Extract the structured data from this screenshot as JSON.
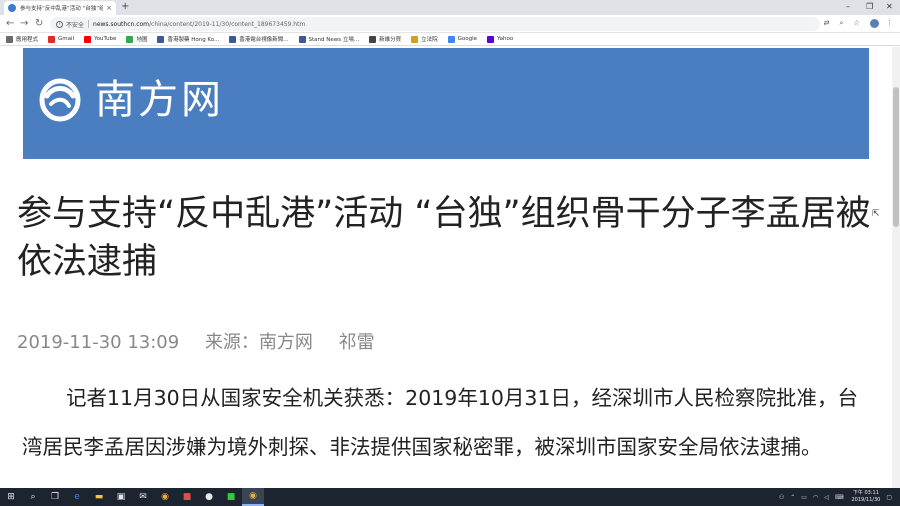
{
  "browser": {
    "tab": {
      "title": "参与支持“反中乱港”活动 “台独”组织骨干分子李孟居被依法逮捕",
      "close": "×"
    },
    "new_tab": "+",
    "window_controls": {
      "minimize": "–",
      "restore": "❐",
      "close": "✕"
    },
    "nav": {
      "back": "←",
      "forward": "→",
      "reload": "↻"
    },
    "address": {
      "security_label": "不安全",
      "host": "news.southcn.com",
      "path": "/china/content/2019-11/30/content_189673459.htm"
    },
    "bookmarks": [
      {
        "label": "應用程式",
        "color": "#6a6a6a"
      },
      {
        "label": "Gmail",
        "color": "#d93025"
      },
      {
        "label": "YouTube",
        "color": "#ff0000"
      },
      {
        "label": "地圖",
        "color": "#34a853"
      },
      {
        "label": "香港製藥 Hong Ko...",
        "color": "#3b5998"
      },
      {
        "label": "香港電台視像新聞...",
        "color": "#3b5998"
      },
      {
        "label": "Stand News 立場...",
        "color": "#3b5998"
      },
      {
        "label": "新維分買",
        "color": "#444444"
      },
      {
        "label": "立法院",
        "color": "#d4a017"
      },
      {
        "label": "Google",
        "color": "#4285f4"
      },
      {
        "label": "Yahoo",
        "color": "#5f01d1"
      }
    ]
  },
  "page": {
    "logo_text": "南方网",
    "headline": "参与支持“反中乱港”活动 “台独”组织骨干分子李孟居被依法逮捕",
    "meta": {
      "datetime": "2019-11-30 13:09",
      "source": "来源：南方网",
      "author": "祁雷"
    },
    "body": "记者11月30日从国家安全机关获悉：2019年10月31日，经深圳市人民检察院批准，台湾居民李孟居因涉嫌为境外刺探、非法提供国家秘密罪，被深圳市国家安全局依法逮捕。"
  },
  "taskbar": {
    "icons": [
      "windows-start",
      "search",
      "task-view",
      "edge",
      "file-explorer",
      "store",
      "mail",
      "chrome",
      "yb",
      "wechat",
      "line",
      "chrome-active"
    ],
    "clock": {
      "period_time": "下午 03:11",
      "date": "2019/11/30"
    }
  }
}
